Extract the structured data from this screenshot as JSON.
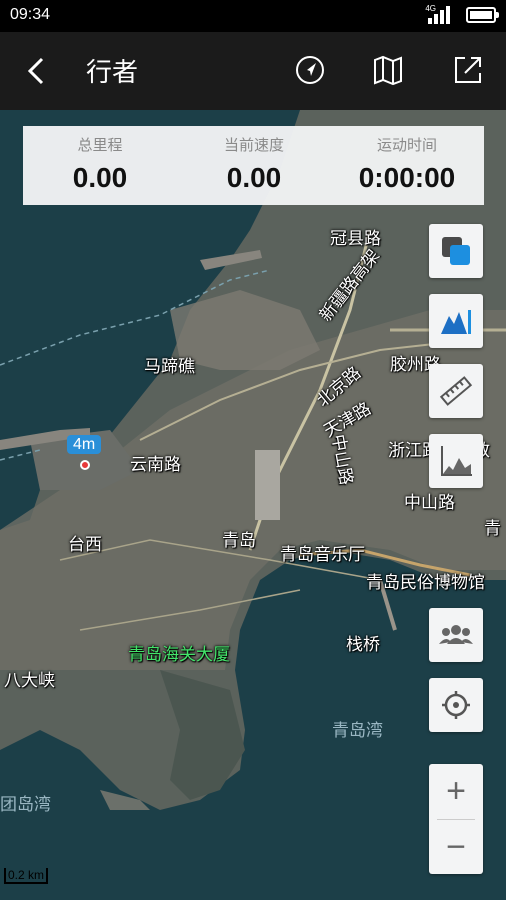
{
  "status_bar": {
    "time": "09:34",
    "network": "4G"
  },
  "app_bar": {
    "title": "行者",
    "actions": [
      "location-arrow-icon",
      "map-icon",
      "share-icon"
    ]
  },
  "stats": [
    {
      "label": "总里程",
      "value": "0.00"
    },
    {
      "label": "当前速度",
      "value": "0.00"
    },
    {
      "label": "运动时间",
      "value": "0:00:00"
    }
  ],
  "map": {
    "marker_label": "4m",
    "scale_label": "0.2 km",
    "labels": {
      "guanxian": "冠县路",
      "xinjiang": "新疆路高架",
      "jiaozhou": "胶州路",
      "matijiao": "马蹄礁",
      "beijing": "北京路",
      "tianjin": "天津路",
      "zhongshan_v": "中山路",
      "zhejiang": "浙江路天主教",
      "zhongshan_h": "中山路",
      "yunnan": "云南路",
      "taixi": "台西",
      "qingdao": "青岛",
      "yinyueting": "青岛音乐厅",
      "minsu": "青岛民俗博物馆",
      "haiguan": "青岛海关大厦",
      "zhanqiao": "栈桥",
      "badaxia": "八大峡",
      "qingdaowan": "青岛湾",
      "tuandaowan": "团岛湾",
      "qing_partial": "青"
    }
  },
  "tools": [
    "layers-icon",
    "elevation-icon",
    "ruler-icon",
    "altitude-chart-icon",
    "team-icon",
    "locate-icon"
  ],
  "zoom": {
    "in": "+",
    "out": "−"
  }
}
